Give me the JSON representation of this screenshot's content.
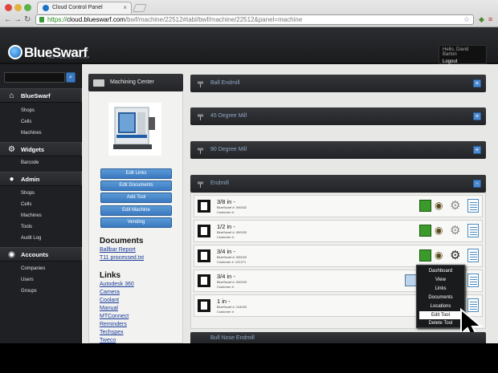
{
  "browser": {
    "tab_title": "Cloud Control Panel",
    "url_scheme": "https://",
    "url_host": "cloud.blueswarf.com",
    "url_path": "/bwf/machine/22512#tabl/bwf/machine/22512&panel=machine"
  },
  "header": {
    "logo": "BlueSwarf",
    "tagline": "THE PERFECT CHIP",
    "user_greeting": "Hello, David Barton",
    "logout": "Logout"
  },
  "sidebar": {
    "search_placeholder": "",
    "sections": [
      {
        "label": "BlueSwarf",
        "icon": "home-icon",
        "items": [
          "Shops",
          "Cells",
          "Machines"
        ]
      },
      {
        "label": "Widgets",
        "icon": "gear-icon",
        "items": [
          "Barcode"
        ]
      },
      {
        "label": "Admin",
        "icon": "user-icon",
        "items": [
          "Shops",
          "Cells",
          "Machines",
          "Tools",
          "Audit Log"
        ]
      },
      {
        "label": "Accounts",
        "icon": "users-icon",
        "items": [
          "Companies",
          "Users",
          "Groups"
        ]
      }
    ]
  },
  "machine_panel": {
    "title": "Machining Center",
    "buttons": [
      "Edit Links",
      "Edit Documents",
      "Add Tool",
      "Edit Machine",
      "Vending"
    ],
    "documents_heading": "Documents",
    "documents": [
      "Ballbar Report",
      "T11 processed.txt"
    ],
    "links_heading": "Links",
    "links": [
      "Autodesk 360",
      "Camera",
      "Coolant",
      "Manual",
      "MTConnect",
      "Reminders",
      "Techspex",
      "Tweco"
    ]
  },
  "tool_groups": [
    {
      "title": "Ball Endmill",
      "toggle": "+"
    },
    {
      "title": "45 Degree Mill",
      "toggle": "+"
    },
    {
      "title": "90 Degree Mill",
      "toggle": "+"
    },
    {
      "title": "Endmill",
      "toggle": "-"
    },
    {
      "title": "Bull Nose Endmill",
      "toggle": "+"
    }
  ],
  "endmill_tools": [
    {
      "size": "3/8 in -",
      "blueswarf_no": "BlueSwarf #: 000002",
      "customer_no": "Customer #:"
    },
    {
      "size": "1/2 in -",
      "blueswarf_no": "BlueSwarf #: 000003",
      "customer_no": "Customer #:"
    },
    {
      "size": "3/4 in -",
      "blueswarf_no": "BlueSwarf #: 000020",
      "customer_no": "Customer #: 121271"
    },
    {
      "size": "3/4 in -",
      "blueswarf_no": "BlueSwarf #: 000023",
      "customer_no": "Customer #:"
    },
    {
      "size": "1 in -",
      "blueswarf_no": "BlueSwarf #: 104003",
      "customer_no": "Customer #:"
    }
  ],
  "context_menu": {
    "items": [
      "Dashboard",
      "View",
      "Links",
      "Documents",
      "Locations",
      "Edit Tool",
      "Delete Tool"
    ],
    "active": "Edit Tool"
  },
  "colors": {
    "accent_blue": "#3a78c0",
    "status_green": "#3a9a2a",
    "dark_bar": "#232427"
  }
}
